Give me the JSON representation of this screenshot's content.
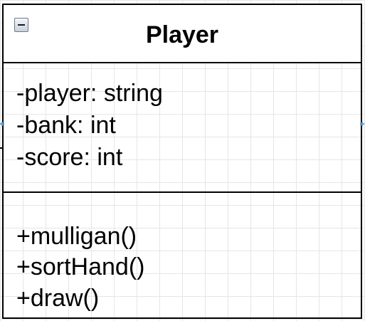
{
  "diagram": {
    "class_name": "Player",
    "attributes": [
      "-player: string",
      "-bank: int",
      "-score: int"
    ],
    "methods": [
      "+mulligan()",
      "+sortHand()",
      "+draw()"
    ],
    "icons": {
      "collapse": "minus-box-icon",
      "connection_point": "x-cross-icon"
    },
    "colors": {
      "border": "#000000",
      "grid": "#e6e6e6",
      "background": "#ffffff",
      "connector": "#5aa0d8"
    }
  }
}
